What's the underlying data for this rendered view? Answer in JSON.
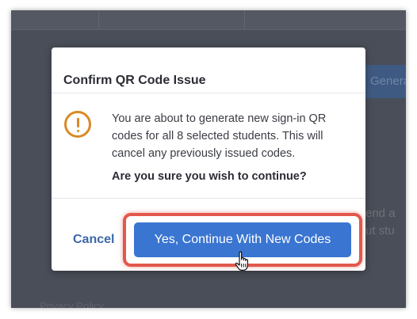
{
  "background": {
    "button_text": "Genera",
    "text_line_1": "end a",
    "text_line_2": "ut stu",
    "footer_text": "Privacy Policy"
  },
  "dialog": {
    "title": "Confirm QR Code Issue",
    "icon": "exclamation-circle-icon",
    "message": "You are about to generate new sign-in QR codes for all 8 selected students. This will cancel any previously issued codes.",
    "question": "Are you sure you wish to continue?",
    "cancel_label": "Cancel",
    "confirm_label": "Yes, Continue With New Codes"
  },
  "colors": {
    "accent": "#3a75d1",
    "warning": "#d98a24",
    "highlight": "#e2584d",
    "link": "#3c68a8"
  },
  "cursor": "hand-pointer-icon"
}
